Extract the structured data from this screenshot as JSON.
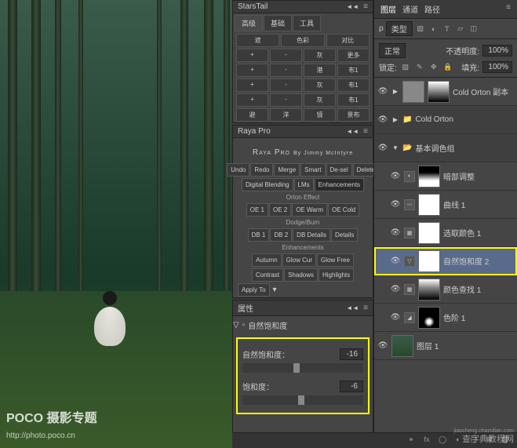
{
  "watermarks": {
    "poco_logo": "POCO 摄影专题",
    "poco_url": "http://photo.poco.cn",
    "zidian": "查字典教程网",
    "zidian_url": "jiaocheng.chazidian.com"
  },
  "starstail": {
    "title": "StarsTail",
    "tabs": [
      "高级",
      "基础",
      "工具"
    ],
    "row1": [
      "遮",
      "色彩",
      "对比"
    ],
    "grid": [
      [
        "+",
        "-",
        "灰",
        "更多"
      ],
      [
        "+",
        "-",
        "港",
        "布1"
      ],
      [
        "+",
        "-",
        "灰",
        "布1"
      ],
      [
        "+",
        "-",
        "灰",
        "布1"
      ]
    ],
    "last_row": [
      "避",
      "洋",
      "镜",
      "景布"
    ]
  },
  "raya": {
    "title": "Raya Pro",
    "subtitle": "Raya Pro",
    "byline": "By Jimmy McIntyre",
    "row1": [
      "Undo",
      "Redo",
      "Merge",
      "Smart",
      "De-sel",
      "Delete"
    ],
    "tabs": [
      "Digital Blending",
      "LMs",
      "Enhancements"
    ],
    "section1": "Orton Effect",
    "orton": [
      "OE 1",
      "OE 2",
      "OE Warm",
      "OE Cold"
    ],
    "section2": "Dodge/Burn",
    "dodge": [
      "DB 1",
      "DB 2",
      "DB Details",
      "Details"
    ],
    "section3": "Enhancements",
    "enh1": [
      "Autumn",
      "Glow Cur",
      "Glow Free"
    ],
    "enh2": [
      "Contrast",
      "Shadows",
      "Highlights"
    ],
    "apply": "Apply To"
  },
  "properties": {
    "panel_title": "属性",
    "adjustment_type": "自然饱和度",
    "sliders": [
      {
        "label": "自然饱和度：",
        "value": "-16",
        "pos": 42
      },
      {
        "label": "饱和度：",
        "value": "-6",
        "pos": 46
      }
    ]
  },
  "layers_panel": {
    "tabs": [
      "图层",
      "通道",
      "路径"
    ],
    "filter_label": "类型",
    "blend_mode": "正常",
    "opacity_label": "不透明度:",
    "opacity_value": "100%",
    "lock_label": "锁定:",
    "fill_label": "填充:",
    "fill_value": "100%",
    "layers": [
      {
        "name": "Cold Orton 副本",
        "mask": "grad"
      },
      {
        "name": "Cold Orton",
        "group": true
      },
      {
        "name": "基本调色组",
        "group": true,
        "expanded": true
      },
      {
        "name": "暗部调整",
        "mask": "grad2",
        "indent": true
      },
      {
        "name": "曲线 1",
        "mask": "white",
        "indent": true
      },
      {
        "name": "选取颜色 1",
        "mask": "white",
        "indent": true
      },
      {
        "name": "自然饱和度 2",
        "mask": "white",
        "indent": true,
        "selected": true
      },
      {
        "name": "颜色查找 1",
        "mask": "streak",
        "indent": true
      },
      {
        "name": "色阶 1",
        "mask": "spot",
        "indent": true
      },
      {
        "name": "图层 1",
        "photo": true
      }
    ]
  },
  "chart_data": null
}
